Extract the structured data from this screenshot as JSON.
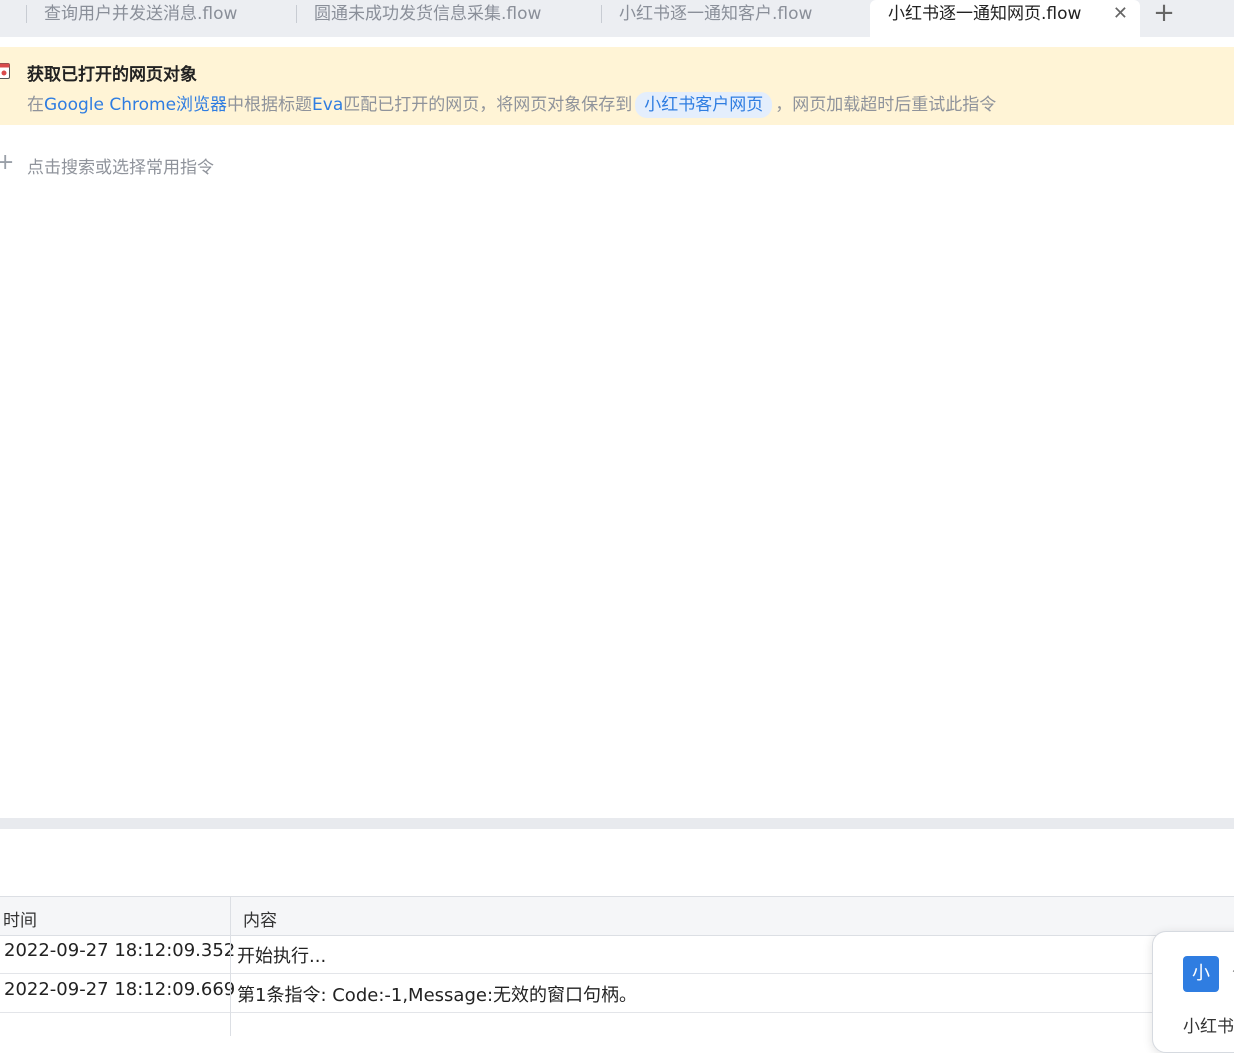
{
  "tabs": [
    {
      "label": "查询用户并发送消息.flow",
      "active": false
    },
    {
      "label": "圆通未成功发货信息采集.flow",
      "active": false
    },
    {
      "label": "小红书逐一通知客户.flow",
      "active": false
    },
    {
      "label": "小红书逐一通知网页.flow",
      "active": true
    }
  ],
  "tab_close": "✕",
  "tab_add": "+",
  "action": {
    "title": "获取已打开的网页对象",
    "desc_prefix": "在",
    "browser": "Google Chrome浏览器",
    "desc_mid1": "中根据标题",
    "title_match": "Eva",
    "desc_mid2": "匹配已打开的网页，将网页对象保存到",
    "variable": "小红书客户网页",
    "desc_suffix": "，网页加载超时后重试此指令"
  },
  "add_command": {
    "plus": "+",
    "label": "点击搜索或选择常用指令"
  },
  "log": {
    "header_time": "时间",
    "header_content": "内容",
    "rows": [
      {
        "time": "2022-09-27 18:12:09.352",
        "content": "开始执行..."
      },
      {
        "time": "2022-09-27 18:12:09.669",
        "content": "第1条指令: Code:-1,Message:无效的窗口句柄。"
      }
    ]
  },
  "popup": {
    "avatar": "小",
    "caret": "^",
    "text": "小红书"
  }
}
